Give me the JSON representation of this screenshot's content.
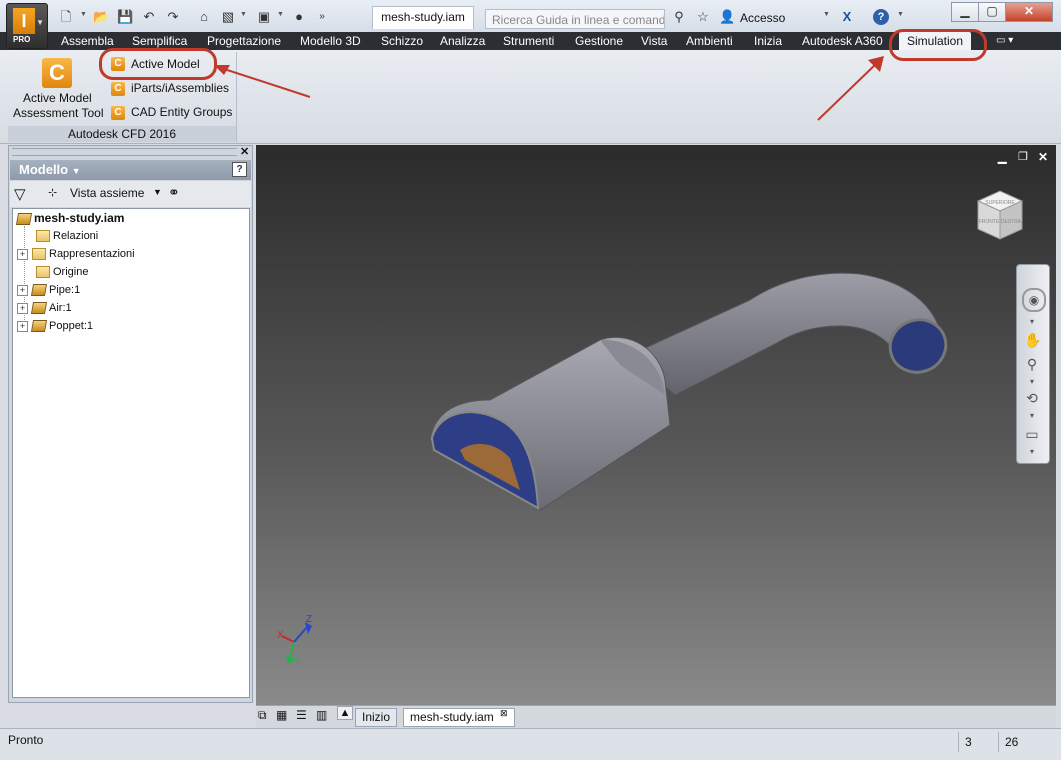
{
  "title": {
    "document": "mesh-study.iam",
    "search_placeholder": "Ricerca Guida in linea e comand",
    "signin": "Accesso"
  },
  "menu": {
    "tabs": [
      "Assembla",
      "Semplifica",
      "Progettazione",
      "Modello 3D",
      "Schizzo",
      "Analizza",
      "Strumenti",
      "Gestione",
      "Vista",
      "Ambienti",
      "Inizia",
      "Autodesk A360"
    ],
    "active_tab": "Simulation"
  },
  "ribbon": {
    "big_button_line1": "Active Model",
    "big_button_line2": "Assessment Tool",
    "active_model": "Active Model",
    "iparts": "iParts/iAssemblies",
    "cad_groups": "CAD Entity Groups",
    "panel_title": "Autodesk CFD 2016"
  },
  "browser": {
    "title": "Modello",
    "view_label": "Vista assieme",
    "tree": {
      "root": "mesh-study.iam",
      "items": [
        "Relazioni",
        "Rappresentazioni",
        "Origine",
        "Pipe:1",
        "Air:1",
        "Poppet:1"
      ]
    }
  },
  "bottom_tabs": {
    "home": "Inizio",
    "doc": "mesh-study.iam"
  },
  "status": {
    "text": "Pronto",
    "count1": "3",
    "count2": "26"
  },
  "viewcube": {
    "top": "SUPERIORE",
    "front": "FRONTE",
    "right": "DESTRA"
  },
  "triad": {
    "x": "X",
    "y": "Y",
    "z": "Z"
  },
  "colors": {
    "highlight_ring": "#c0392b",
    "menubar": "#2b2f34",
    "cfd_orange": "#e0860c"
  }
}
